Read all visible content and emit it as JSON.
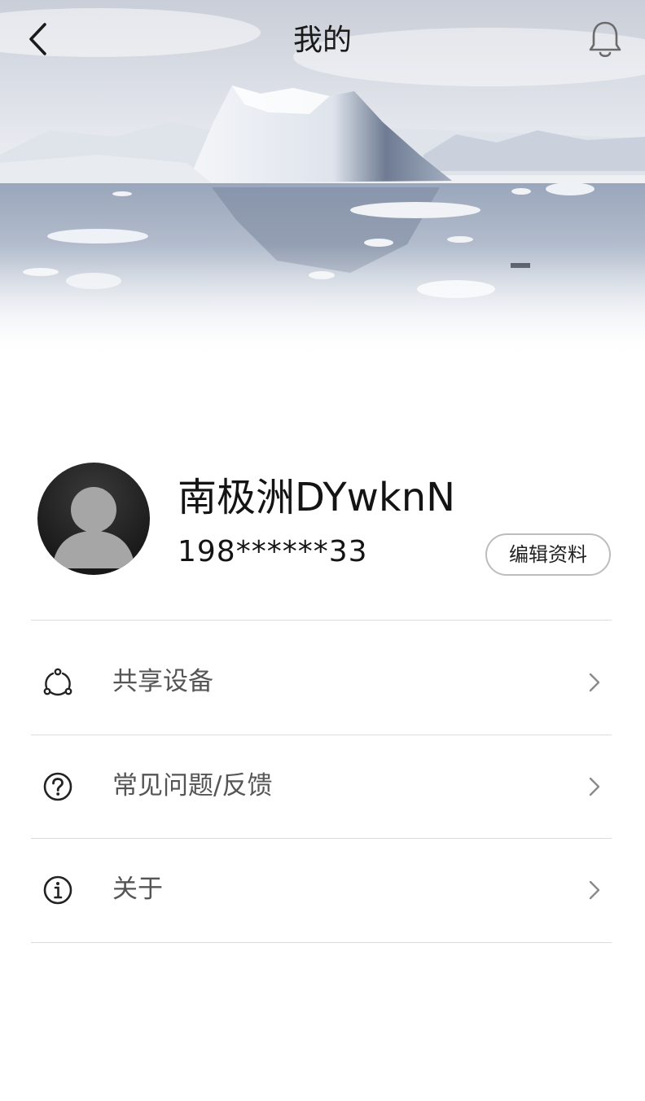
{
  "nav": {
    "title": "我的",
    "back_icon": "chevron-left-icon",
    "bell_icon": "bell-icon"
  },
  "profile": {
    "username": "南极洲DYwknN",
    "phone": "198******33",
    "edit_label": "编辑资料",
    "avatar_icon": "default-avatar-icon"
  },
  "menu": {
    "items": [
      {
        "label": "共享设备",
        "icon": "share-icon"
      },
      {
        "label": "常见问题/反馈",
        "icon": "question-circle-icon"
      },
      {
        "label": "关于",
        "icon": "info-circle-icon"
      }
    ],
    "chevron_icon": "chevron-right-icon"
  },
  "colors": {
    "title_text": "#1a1a1a",
    "menu_text": "#555555",
    "divider": "#dcdcdc",
    "button_border": "#bdbdbd"
  }
}
